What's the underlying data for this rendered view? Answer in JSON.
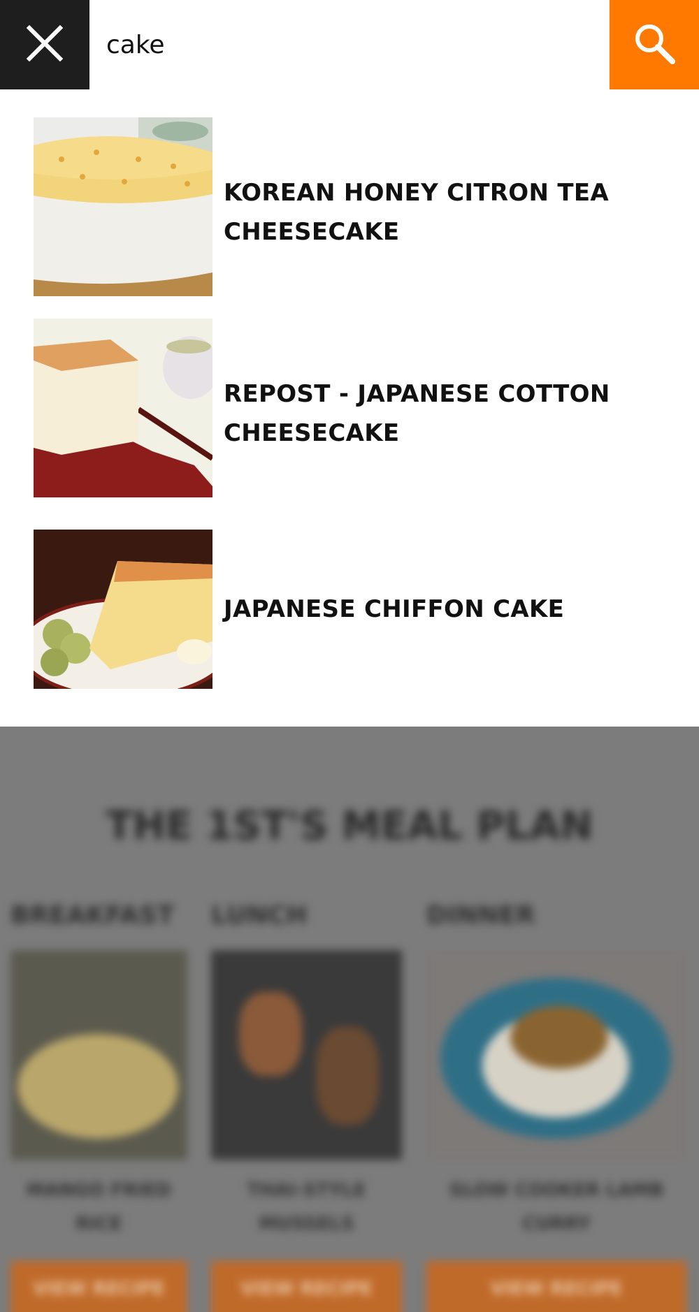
{
  "search": {
    "query": "cake",
    "close_icon": "close-icon",
    "search_icon": "search-icon",
    "accent_color": "#ff7900"
  },
  "results": [
    {
      "title": "KOREAN HONEY CITRON TEA CHEESECAKE",
      "thumbnail": "cheesecake-photo"
    },
    {
      "title": "REPOST - JAPANESE COTTON CHEESECAKE",
      "thumbnail": "cotton-cheesecake-photo"
    },
    {
      "title": "JAPANESE CHIFFON CAKE",
      "thumbnail": "chiffon-cake-photo"
    }
  ],
  "background_page": {
    "title": "THE 1ST'S MEAL PLAN",
    "meals": [
      {
        "label": "BREAKFAST",
        "name": "MANGO FRIED RICE",
        "button": "VIEW RECIPE"
      },
      {
        "label": "LUNCH",
        "name": "THAI-STYLE MUSSELS",
        "button": "VIEW RECIPE"
      },
      {
        "label": "DINNER",
        "name": "SLOW COOKER LAMB CURRY",
        "button": "VIEW RECIPE"
      }
    ]
  }
}
